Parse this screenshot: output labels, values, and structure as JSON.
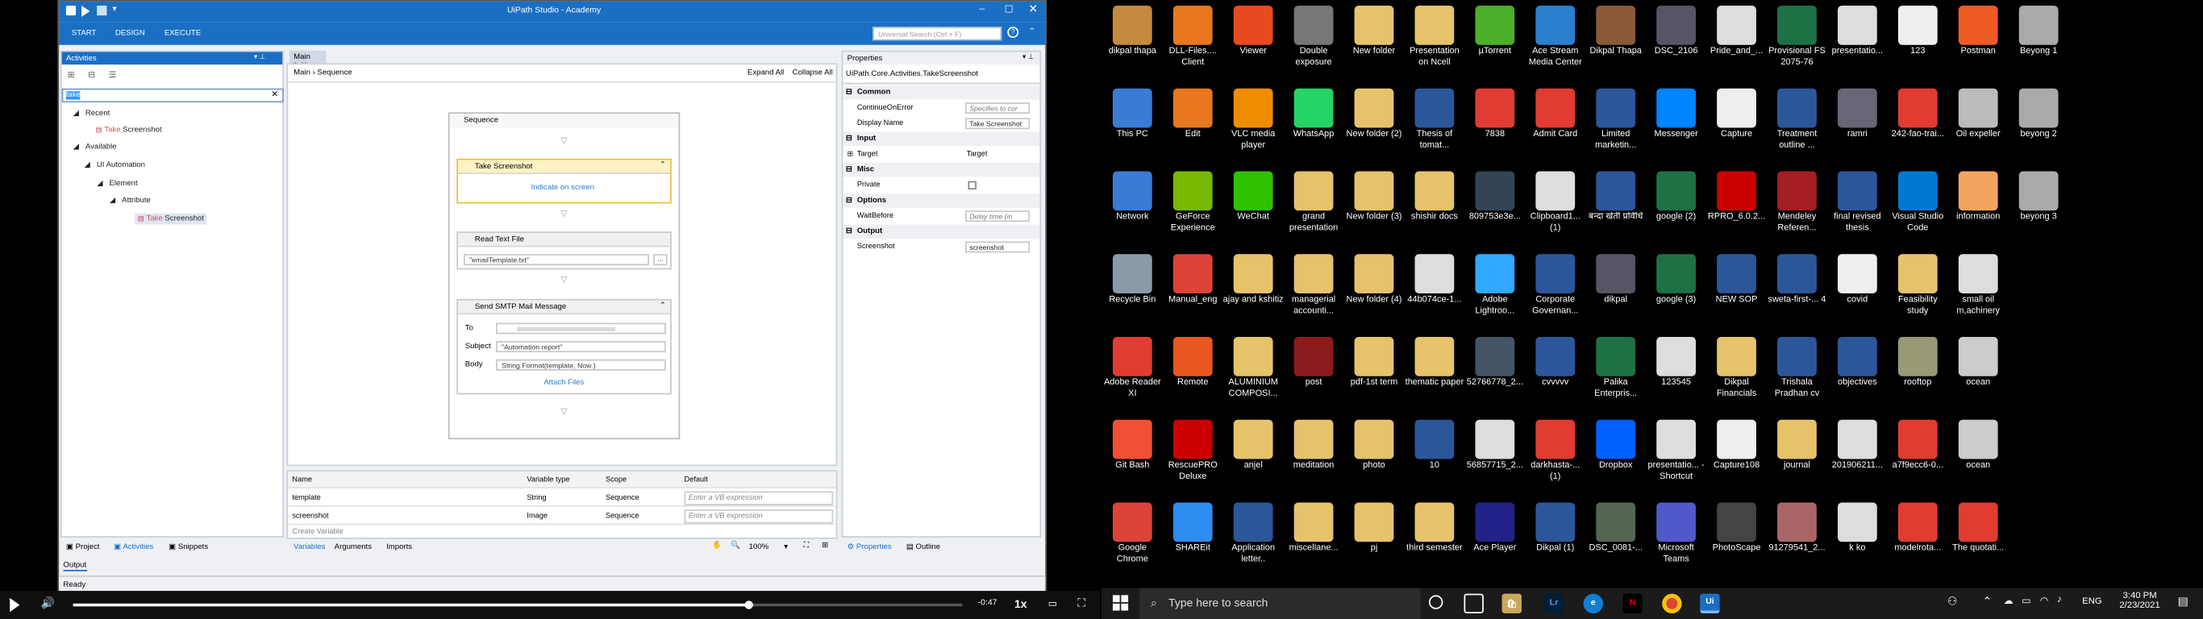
{
  "app": {
    "title": "UiPath Studio - Academy",
    "ribbon": [
      "START",
      "DESIGN",
      "EXECUTE"
    ],
    "search_placeholder": "Universal Search (Ctrl + F)",
    "activities": {
      "title": "Activities",
      "search_value": "take",
      "tree": {
        "recent": "Recent",
        "recent_item_hl": "Take",
        "recent_item_rest": " Screenshot",
        "available": "Available",
        "ui_automation": "UI Automation",
        "element": "Element",
        "attribute": "Attribute",
        "item_hl": "Take",
        "item_rest": " Screenshot"
      }
    },
    "designer": {
      "tab": "Main *",
      "breadcrumb": "Main  ›  Sequence",
      "expand_all": "Expand All",
      "collapse_all": "Collapse All",
      "sequence_title": "Sequence",
      "take_screenshot": {
        "title": "Take Screenshot",
        "link": "Indicate on screen"
      },
      "read_text_file": {
        "title": "Read Text File",
        "value": "\"emailTemplate.txt\"",
        "browse": "..."
      },
      "send_smtp": {
        "title": "Send SMTP Mail Message",
        "to_label": "To",
        "subject_label": "Subject",
        "subject_value": "\"Automation report\"",
        "body_label": "Body",
        "body_value": "String.Format(template, Now )",
        "attach": "Attach Files"
      }
    },
    "variables": {
      "headers": [
        "Name",
        "Variable type",
        "Scope",
        "Default"
      ],
      "rows": [
        {
          "name": "template",
          "type": "String",
          "scope": "Sequence",
          "default": "Enter a VB expression"
        },
        {
          "name": "screenshot",
          "type": "Image",
          "scope": "Sequence",
          "default": "Enter a VB expression"
        }
      ],
      "create": "Create Variable",
      "tabs": [
        "Variables",
        "Arguments",
        "Imports"
      ],
      "zoom": "100%"
    },
    "properties": {
      "title": "Properties",
      "class": "UiPath.Core.Activities.TakeScreenshot",
      "groups": {
        "common": "Common",
        "input": "Input",
        "misc": "Misc",
        "options": "Options",
        "output": "Output"
      },
      "rows": {
        "continue_label": "ContinueOnError",
        "continue_value": "Specifies to cor",
        "display_label": "Display Name",
        "display_value": "Take Screenshot",
        "target_label": "Target",
        "target_value": "Target",
        "private_label": "Private",
        "wait_label": "WaitBefore",
        "wait_value": "Delay time (in",
        "screenshot_label": "Screenshot",
        "screenshot_value": "screenshot"
      },
      "tabs": [
        "Properties",
        "Outline"
      ]
    },
    "bottom_tabs": [
      "Project",
      "Activities",
      "Snippets"
    ],
    "output_tab": "Output",
    "status": "Ready"
  },
  "video": {
    "time": "-0:47",
    "speed": "1x",
    "progress": 0.76
  },
  "desktop": {
    "icons": [
      [
        "dikpal thapa",
        "#c68a3e"
      ],
      [
        "DLL-Files.... Client",
        "#e8771f"
      ],
      [
        "Viewer",
        "#e84a1f"
      ],
      [
        "Double exposure",
        "#777"
      ],
      [
        "New folder",
        "#e6c36b"
      ],
      [
        "Presentation on Ncell",
        "#e6c36b"
      ],
      [
        "µTorrent",
        "#4caf2c"
      ],
      [
        "Ace Stream Media Center",
        "#2a7fcf"
      ],
      [
        "Dikpal Thapa",
        "#8a5a3a"
      ],
      [
        "DSC_2106",
        "#556"
      ],
      [
        "Pride_and_...",
        "#ddd"
      ],
      [
        "Provisional FS 2075-76",
        "#1e7145"
      ],
      [
        "presentatio...",
        "#ddd"
      ],
      [
        "123",
        "#eee"
      ],
      [
        "Postman",
        "#ef5b25"
      ],
      [
        "Beyong 1",
        "#aaa"
      ],
      [
        "This PC",
        "#3a7bd5"
      ],
      [
        "Edit",
        "#e8771f"
      ],
      [
        "VLC media player",
        "#f08c00"
      ],
      [
        "WhatsApp",
        "#25d366"
      ],
      [
        "New folder (2)",
        "#e6c36b"
      ],
      [
        "Thesis of tomat...",
        "#2b579a"
      ],
      [
        "7838",
        "#e03c31"
      ],
      [
        "Admit Card",
        "#e03c31"
      ],
      [
        "Limited marketin...",
        "#2b579a"
      ],
      [
        "Messenger",
        "#0084ff"
      ],
      [
        "Capture",
        "#eee"
      ],
      [
        "Treatment outline ...",
        "#2b579a"
      ],
      [
        "ramri",
        "#667"
      ],
      [
        "242-fao-trai...",
        "#e03c31"
      ],
      [
        "Oil expeller",
        "#bbb"
      ],
      [
        "beyong 2",
        "#aaa"
      ],
      [
        "Network",
        "#3a7bd5"
      ],
      [
        "GeForce Experience",
        "#76b900"
      ],
      [
        "WeChat",
        "#2dc100"
      ],
      [
        "grand presentation",
        "#e6c36b"
      ],
      [
        "New folder (3)",
        "#e6c36b"
      ],
      [
        "shishir docs",
        "#e6c36b"
      ],
      [
        "809753e3e...",
        "#345"
      ],
      [
        "Clipboard1... (1)",
        "#ddd"
      ],
      [
        "बन्दा खेती प्रविधि",
        "#2b579a"
      ],
      [
        "google (2)",
        "#1e7145"
      ],
      [
        "RPRO_6.0.2...",
        "#c00"
      ],
      [
        "Mendeley Referen...",
        "#a51e22"
      ],
      [
        "final revised thesis",
        "#2b579a"
      ],
      [
        "Visual Studio Code",
        "#0078d4"
      ],
      [
        "information",
        "#f4a460"
      ],
      [
        "beyong 3",
        "#aaa"
      ],
      [
        "Recycle Bin",
        "#8a9aa8"
      ],
      [
        "Manual_eng",
        "#db4437"
      ],
      [
        "ajay and kshitiz",
        "#e6c36b"
      ],
      [
        "managerial accounti...",
        "#e6c36b"
      ],
      [
        "New folder (4)",
        "#e6c36b"
      ],
      [
        "44b074ce-1...",
        "#ddd"
      ],
      [
        "Adobe Lightroo...",
        "#31a8ff"
      ],
      [
        "Corporate Governan...",
        "#2b579a"
      ],
      [
        "dikpal",
        "#556"
      ],
      [
        "google (3)",
        "#1e7145"
      ],
      [
        "NEW SOP",
        "#2b579a"
      ],
      [
        "sweta-first-... 4",
        "#2b579a"
      ],
      [
        "covid",
        "#eee"
      ],
      [
        "Feasibility study",
        "#e6c36b"
      ],
      [
        "small oil m,achinery",
        "#ddd"
      ],
      [
        "",
        "#000"
      ],
      [
        "Adobe Reader XI",
        "#e03c31"
      ],
      [
        "Remote",
        "#e8571f"
      ],
      [
        "ALUMINIUM COMPOSI...",
        "#e6c36b"
      ],
      [
        "post",
        "#8b1a1a"
      ],
      [
        "pdf-1st term",
        "#e6c36b"
      ],
      [
        "thematic paper",
        "#e6c36b"
      ],
      [
        "52766778_2...",
        "#456"
      ],
      [
        "cvvvvv",
        "#2b579a"
      ],
      [
        "Palika Enterpris...",
        "#1e7145"
      ],
      [
        "123545",
        "#ddd"
      ],
      [
        "Dikpal Financials",
        "#e6c36b"
      ],
      [
        "Trishala Pradhan cv",
        "#2b579a"
      ],
      [
        "objectives",
        "#2b579a"
      ],
      [
        "rooftop",
        "#997"
      ],
      [
        "ocean",
        "#ccc"
      ],
      [
        "",
        "#000"
      ],
      [
        "Git Bash",
        "#f05033"
      ],
      [
        "RescuePRO Deluxe",
        "#c00"
      ],
      [
        "anjel",
        "#e6c36b"
      ],
      [
        "meditation",
        "#e6c36b"
      ],
      [
        "photo",
        "#e6c36b"
      ],
      [
        "10",
        "#2b579a"
      ],
      [
        "56857715_2...",
        "#ddd"
      ],
      [
        "darkhasta-... (1)",
        "#e03c31"
      ],
      [
        "Dropbox",
        "#0061ff"
      ],
      [
        "presentatio... - Shortcut",
        "#ddd"
      ],
      [
        "Capture108",
        "#eee"
      ],
      [
        "journal",
        "#e6c36b"
      ],
      [
        "201906211...",
        "#ddd"
      ],
      [
        "a7f9ecc6-0...",
        "#e03c31"
      ],
      [
        "ocean",
        "#ccc"
      ],
      [
        "",
        "#000"
      ],
      [
        "Google Chrome",
        "#db4437"
      ],
      [
        "SHAREit",
        "#2d8cf0"
      ],
      [
        "Application letter..",
        "#2b579a"
      ],
      [
        "miscellane...",
        "#e6c36b"
      ],
      [
        "pj",
        "#e6c36b"
      ],
      [
        "third semester",
        "#e6c36b"
      ],
      [
        "Ace Player",
        "#228"
      ],
      [
        "Dikpal (1)",
        "#2b579a"
      ],
      [
        "DSC_0081-...",
        "#565"
      ],
      [
        "Microsoft Teams",
        "#5059c9"
      ],
      [
        "PhotoScape",
        "#444"
      ],
      [
        "91279541_2...",
        "#a66"
      ],
      [
        "k ko",
        "#ddd"
      ],
      [
        "modelrota...",
        "#e03c31"
      ],
      [
        "The quotati...",
        "#e03c31"
      ],
      [
        "",
        "#000"
      ]
    ]
  },
  "taskbar": {
    "search": "Type here to search",
    "lang": "ENG",
    "time": "3:40 PM",
    "date": "2/23/2021"
  }
}
